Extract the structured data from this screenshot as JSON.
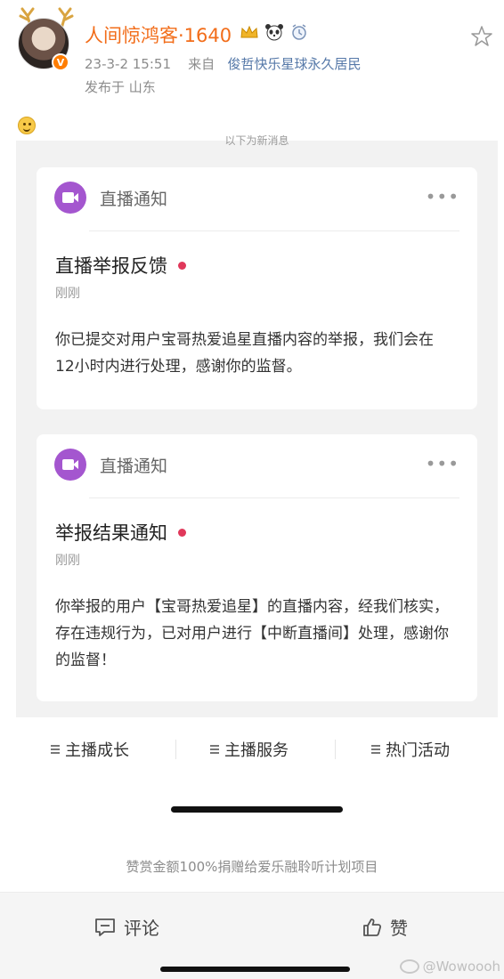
{
  "post": {
    "username": "人间惊鸿客·1640",
    "verified_badge": "V",
    "user_icons": [
      "crown-icon",
      "panda-icon",
      "alarm-clock-icon"
    ],
    "timestamp": "23-3-2 15:51",
    "source_prefix": "来自",
    "source": "俊哲快乐星球永久居民",
    "location": "发布于 山东",
    "emoji": "smile-emoji"
  },
  "panel": {
    "cutoff_text": "以下为新消息",
    "cards": [
      {
        "header": "直播通知",
        "title": "直播举报反馈",
        "time": "刚刚",
        "body": "你已提交对用户宝哥热爱追星直播内容的举报，我们会在12小时内进行处理，感谢你的监督。"
      },
      {
        "header": "直播通知",
        "title": "举报结果通知",
        "time": "刚刚",
        "body": "你举报的用户【宝哥热爱追星】的直播内容，经我们核实，存在违规行为，已对用户进行【中断直播间】处理，感谢你的监督！"
      }
    ],
    "more_label": "•••"
  },
  "tabs": [
    {
      "label": "主播成长"
    },
    {
      "label": "主播服务"
    },
    {
      "label": "热门活动"
    }
  ],
  "reward_text": "赞赏金额100%捐赠给爱乐融聆听计划项目",
  "bottom": {
    "comment_label": "评论",
    "like_label": "赞",
    "watermark": "@Wowoooh"
  },
  "colors": {
    "username": "#f26d1a",
    "source_link": "#5578a8",
    "live_icon": "#a456cf",
    "red_dot": "#e0385a"
  }
}
